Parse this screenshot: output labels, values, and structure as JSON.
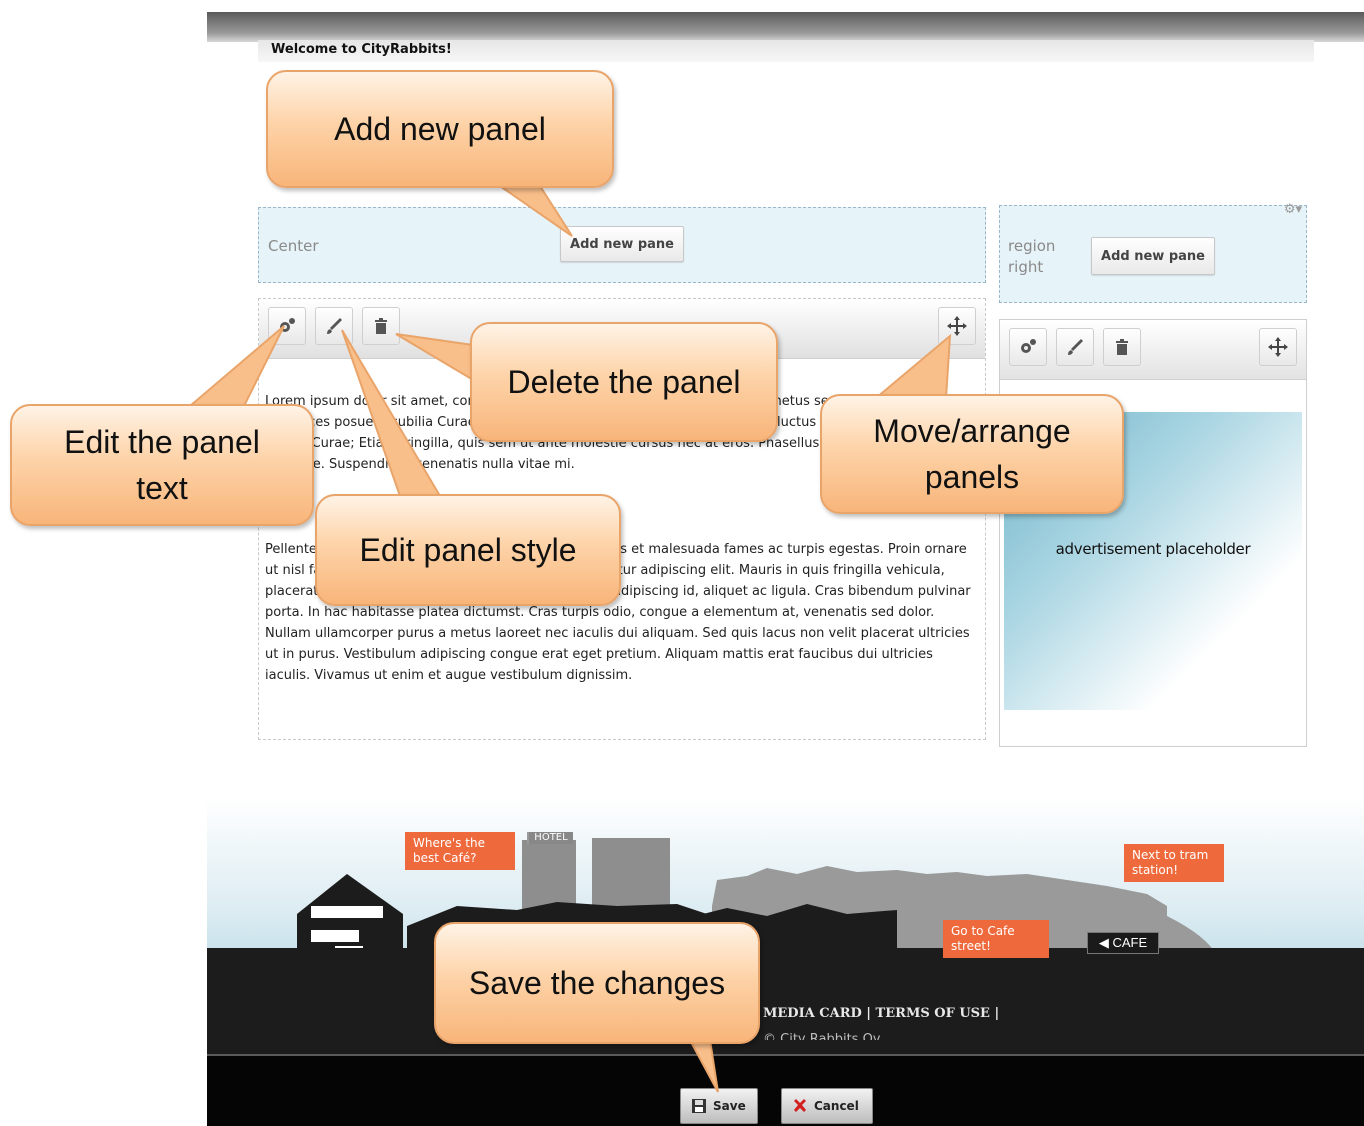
{
  "header": {
    "welcome": "Welcome to CityRabbits!"
  },
  "regions": {
    "center": {
      "label": "Center",
      "add_button": "Add new pane"
    },
    "right": {
      "label_line1": "region",
      "label_line2": "right",
      "add_button": "Add new pane",
      "settings_icon": "gear-icon"
    }
  },
  "panel_center": {
    "paragraph1": "Lorem ipsum dolor sit amet, consectetur adipiscing elit. Fermentum eu lacus metus sed faucibus orci luctus et ultrices posuere cubilia Curae; Donec ipsum ipsum, fringilla in faucibus orci luctus et ultrices posuere cubilia Curae; Etiam fringilla, quis sem ut ante molestie cursus nec at eros. Phasellus gravida est sed lorem molestie. Suspendisse venenatis nulla vitae mi.",
    "paragraph2": "Pellentesque habitant morbi tristique senectus et netus et malesuada fames ac turpis egestas. Proin ornare ut nisl faucibus. Lorem ipsum dolor sit amet, consectetur adipiscing elit. Mauris in quis fringilla vehicula, placerat quis lacus. Aliquam libero urna, semper non adipiscing id, aliquet ac ligula. Cras bibendum pulvinar porta. In hac habitasse platea dictumst. Cras turpis odio, congue a elementum at, venenatis sed dolor. Nullam ullamcorper purus a metus laoreet nec iaculis dui aliquam. Sed quis lacus non velit placerat ultricies ut in purus. Vestibulum adipiscing congue erat eget pretium. Aliquam mattis erat faucibus dui ultricies iaculis. Vivamus ut enim et augue vestibulum dignissim."
  },
  "panel_right": {
    "ad_text": "advertisement placeholder"
  },
  "toolbar_icons": [
    "settings-gear-icon",
    "brush-icon",
    "trash-icon",
    "move-arrows-icon"
  ],
  "footer": {
    "bubble_cafe": "Where's the best Café?",
    "bubble_tram": "Next to tram station!",
    "bubble_street": "Go to Cafe street!",
    "hotel_sign": "HOTEL",
    "cafe_sign": "◀ CAFE",
    "links": "MEDIA CARD | TERMS OF USE |",
    "copyright": "© City Rabbits Oy"
  },
  "actions": {
    "save": "Save",
    "cancel": "Cancel"
  },
  "callouts": {
    "add_panel": "Add new panel",
    "delete_panel": "Delete the panel",
    "edit_text": "Edit the panel text",
    "move_panels": "Move/arrange panels",
    "edit_style": "Edit panel style",
    "save_changes": "Save the changes"
  },
  "colors": {
    "callout_fill": "#fdd3a8",
    "callout_border": "#e9a46a",
    "region_bg": "#e6f3f8",
    "footer_orange": "#ee6a3c"
  }
}
